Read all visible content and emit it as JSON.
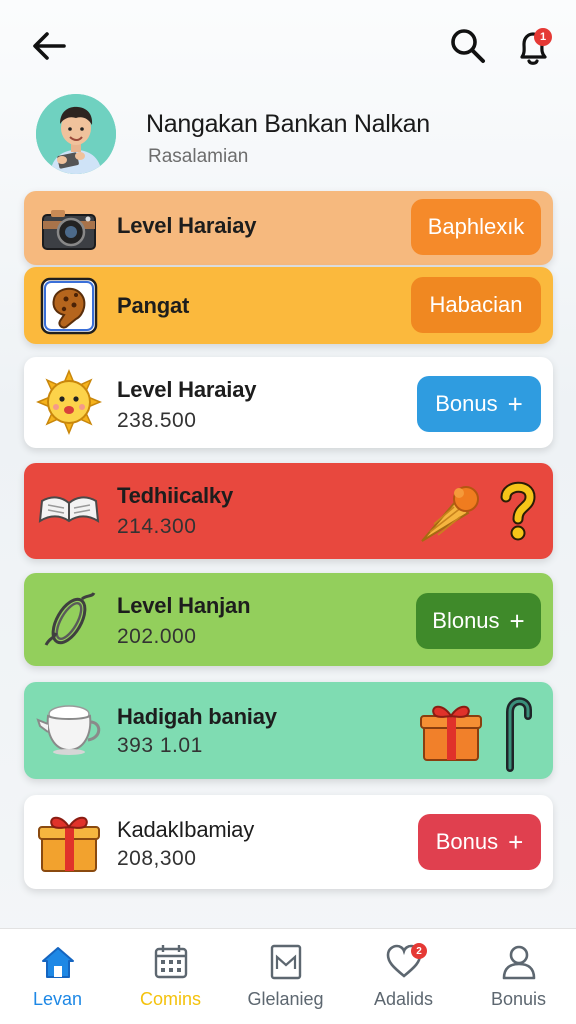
{
  "header": {
    "notification_count": "1"
  },
  "profile": {
    "name": "Nangakan Bankan Nalkan",
    "subtitle": "Rasalamian"
  },
  "cards": [
    {
      "title": "Level Haraiay",
      "value": "",
      "button": "Baphlexık",
      "icon": "camera-icon",
      "bg": "#f6b97e",
      "button_color": "#f58a2a"
    },
    {
      "title": "Pangat",
      "value": "",
      "button": "Habacian",
      "icon": "cookie-icon",
      "bg": "#fbb93d",
      "button_color": "#f08821"
    },
    {
      "title": "Level Haraiay",
      "value": "238.500",
      "button": "Bonus",
      "icon": "sun-icon",
      "bg": "#ffffff",
      "button_color": "#2f9ce0"
    },
    {
      "title": "Tedhiicalky",
      "value": "214.300",
      "button": "",
      "icon": "open-book-icon",
      "bg": "#e8483e",
      "button_color": ""
    },
    {
      "title": "Level Hanjan",
      "value": "202.000",
      "button": "Blonus",
      "icon": "rope-icon",
      "bg": "#93cf5c",
      "button_color": "#3f8a2a"
    },
    {
      "title": "Hadigah baniay",
      "value": "393 1.01",
      "button": "",
      "icon": "teapot-icon",
      "bg": "#7fdcb2",
      "button_color": ""
    },
    {
      "title": "KadakIbamiay",
      "value": "208,300",
      "button": "Bonus",
      "icon": "gift-icon",
      "bg": "#ffffff",
      "button_color": "#e0404f"
    }
  ],
  "nav": [
    {
      "label": "Levan",
      "icon": "home-icon",
      "active": true
    },
    {
      "label": "Comins",
      "icon": "calendar-icon",
      "active": false
    },
    {
      "label": "Glelanieg",
      "icon": "bookmark-icon",
      "active": false
    },
    {
      "label": "Adalids",
      "icon": "heart-icon",
      "badge": "2",
      "active": false
    },
    {
      "label": "Bonuis",
      "icon": "user-icon",
      "active": false
    }
  ],
  "colors": {
    "accent_blue": "#1e88e5",
    "nav_active_text": "#f4c20d"
  }
}
